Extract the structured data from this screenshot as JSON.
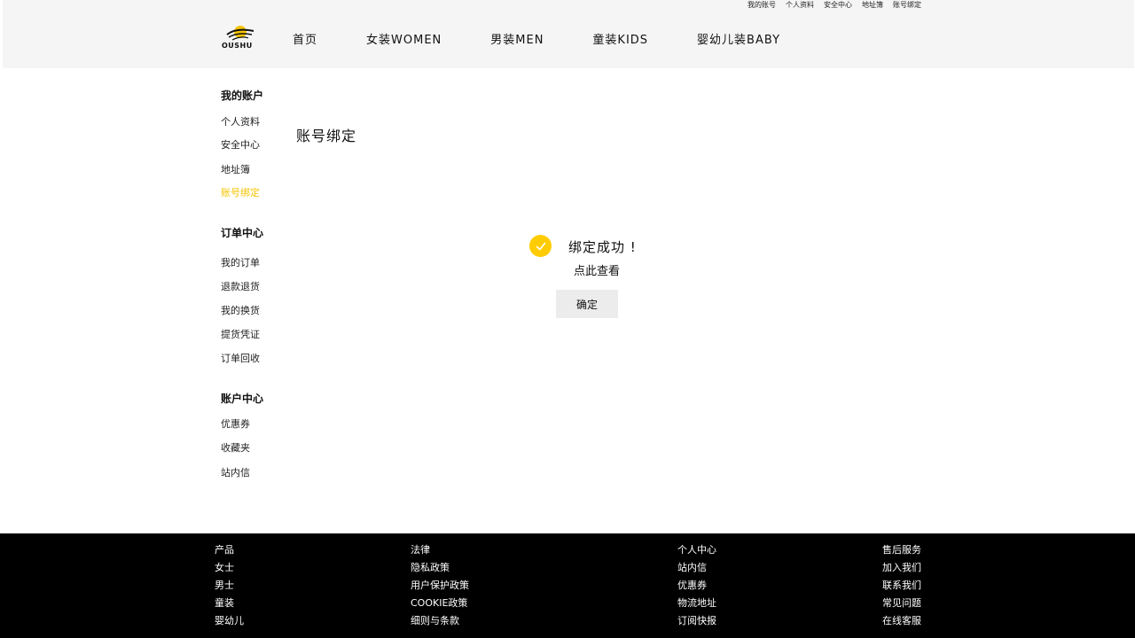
{
  "topbar": {
    "links": [
      "我的账号",
      "个人资料",
      "安全中心",
      "地址簿",
      "账号绑定"
    ]
  },
  "logo": {
    "text": "OUSHU"
  },
  "nav": {
    "items": [
      "首页",
      "女装WOMEN",
      "男装MEN",
      "童装KIDS",
      "婴幼儿装BABY"
    ]
  },
  "sidebar": {
    "account": {
      "heading": "我的账户",
      "items": [
        "个人资料",
        "安全中心",
        "地址簿",
        "账号绑定"
      ]
    },
    "orders": {
      "heading": "订单中心",
      "items": [
        "我的订单",
        "退款退货",
        "我的换货",
        "提货凭证",
        "订单回收"
      ]
    },
    "wallet": {
      "heading": "账户中心",
      "items": [
        "优惠券",
        "收藏夹",
        "站内信"
      ]
    },
    "active_item": "账号绑定"
  },
  "main": {
    "title": "账号绑定"
  },
  "dialog": {
    "icon": "check-icon",
    "message": "绑定成功 !",
    "link": "点此查看",
    "confirm": "确定"
  },
  "footer": {
    "col1": [
      "产品",
      "女士",
      "男士",
      "童装",
      "婴幼儿"
    ],
    "col2": [
      "法律",
      "隐私政策",
      "用户保护政策",
      "COOKIE政策",
      "细则与条款"
    ],
    "col3": [
      "个人中心",
      "站内信",
      "优惠券",
      "物流地址",
      "订阅快报"
    ],
    "col4": [
      "售后服务",
      "加入我们",
      "联系我们",
      "常见问题",
      "在线客服"
    ]
  },
  "colors": {
    "accent": "#ffcc00",
    "active_link": "#f5c400",
    "footer_bg": "#000000",
    "header_bg": "#f5f5f5"
  }
}
